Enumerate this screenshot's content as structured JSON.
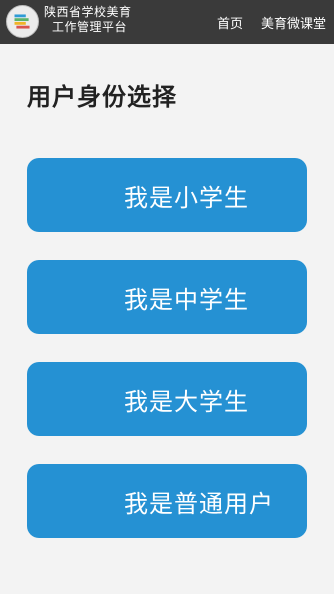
{
  "header": {
    "brand_line1": "陕西省学校美育",
    "brand_line2": "工作管理平台",
    "logo_icon": "school-arts-logo-icon",
    "nav": [
      {
        "label": "首页"
      },
      {
        "label": "美育微课堂"
      }
    ]
  },
  "main": {
    "title": "用户身份选择",
    "options": [
      {
        "label": "我是小学生"
      },
      {
        "label": "我是中学生"
      },
      {
        "label": "我是大学生"
      },
      {
        "label": "我是普通用户"
      }
    ]
  },
  "colors": {
    "topbar": "#3a3a3a",
    "button": "#2591d3",
    "background": "#f3f3f3"
  }
}
